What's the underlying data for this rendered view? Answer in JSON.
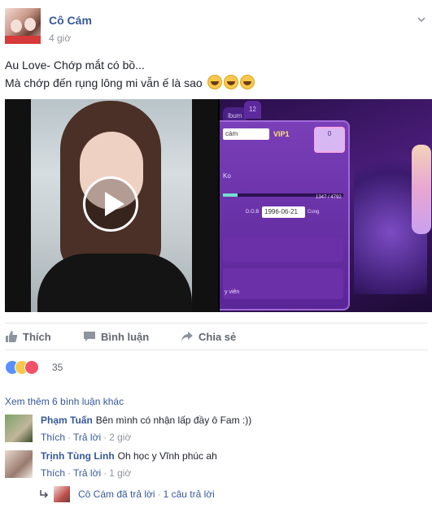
{
  "post": {
    "author": "Cô Cám",
    "time": "4 giờ",
    "text_line1": "Au Love- Chớp mắt có bồ...",
    "text_line2": "Mà chớp đến rụng lông mi vẫn ế là sao",
    "emojis": [
      "laughing-tears",
      "laughing-tears",
      "laughing-tears"
    ]
  },
  "game_screen": {
    "tab_label": "lbum",
    "tab_number": "12",
    "name_field": "cám",
    "vip_label": "VIP1",
    "pink_box_value": "0",
    "field_ko": "Ko",
    "progress_text": "1347 / 4792",
    "progress_fraction": 0.12,
    "dob_label": "D.O.B",
    "dob_value": "1996-06-21",
    "extra_label": "Cung",
    "bottom_label": "y viên"
  },
  "actions": {
    "like": "Thích",
    "comment": "Bình luận",
    "share": "Chia sẻ"
  },
  "reactions": {
    "types": [
      "like",
      "haha",
      "love"
    ],
    "count": "35"
  },
  "comments": {
    "more_link": "Xem thêm 6 bình luận khác",
    "items": [
      {
        "name": "Phạm Tuấn",
        "text": "Bên mình có nhận lấp đầy ô Fam :))",
        "like": "Thích",
        "reply": "Trả lời",
        "time": "2 giờ"
      },
      {
        "name": "Trịnh Tùng Linh",
        "text": "Oh học y Vĩnh phúc ah",
        "like": "Thích",
        "reply": "Trả lời",
        "time": "1 giờ"
      }
    ],
    "reply_summary": {
      "text": "Cô Cám đã trả lời",
      "count": "1 câu trả lời"
    }
  },
  "colors": {
    "link": "#365899",
    "muted": "#90949c",
    "like_blue": "#5890ff",
    "haha_yellow": "#f7c84b",
    "love_red": "#f25268"
  }
}
